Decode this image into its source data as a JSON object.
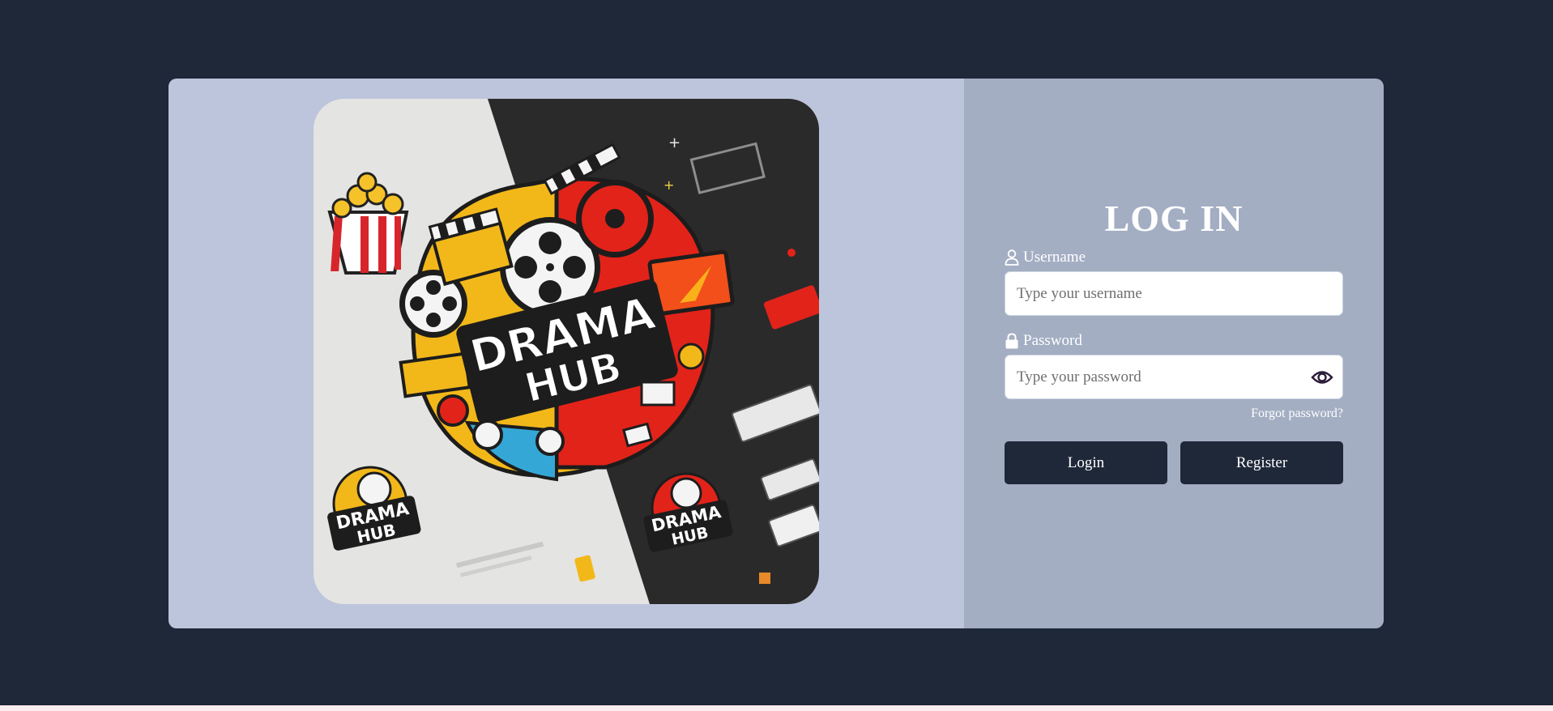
{
  "login": {
    "title": "LOG IN",
    "username": {
      "label": "Username",
      "placeholder": "Type your username",
      "icon": "user-icon"
    },
    "password": {
      "label": "Password",
      "placeholder": "Type your password",
      "icon": "lock-icon",
      "toggle_icon": "eye-icon"
    },
    "forgot_password": "Forgot password?",
    "login_button": "Login",
    "register_button": "Register"
  },
  "brand": {
    "logo_text": "DRAMA HUB"
  },
  "colors": {
    "page_background": "#1f2839",
    "left_panel": "#bcc5db",
    "right_panel": "#a3aec3",
    "button": "#1f2839",
    "accent_red": "#e2231a",
    "accent_yellow": "#f2b81a"
  }
}
